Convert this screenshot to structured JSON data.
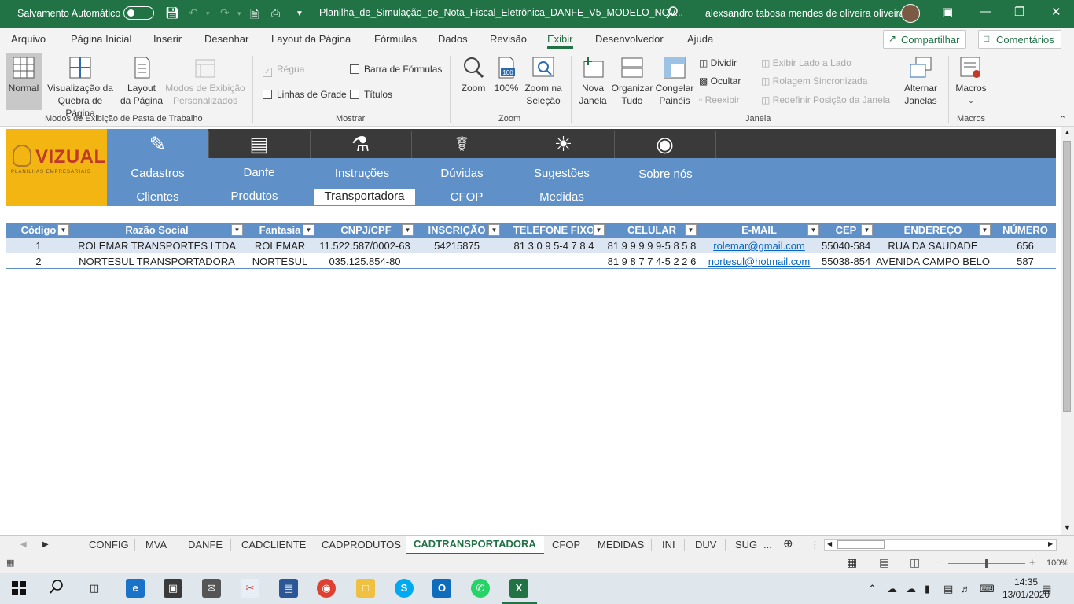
{
  "titlebar": {
    "autosave_label": "Salvamento Automático",
    "document_title": "Planilha_de_Simulação_de_Nota_Fiscal_Eletrônica_DANFE_V5_MODELO_NOV...",
    "user_name": "alexsandro tabosa mendes de oliveira oliveira"
  },
  "menu": {
    "tabs": [
      "Arquivo",
      "Página Inicial",
      "Inserir",
      "Desenhar",
      "Layout da Página",
      "Fórmulas",
      "Dados",
      "Revisão",
      "Exibir",
      "Desenvolvedor",
      "Ajuda"
    ],
    "active_tab": "Exibir",
    "share_label": "Compartilhar",
    "comments_label": "Comentários"
  },
  "ribbon": {
    "views": {
      "normal": "Normal",
      "page_break_1": "Visualização da",
      "page_break_2": "Quebra de Página",
      "page_layout_1": "Layout",
      "page_layout_2": "da Página",
      "custom_1": "Modos de Exibição",
      "custom_2": "Personalizados",
      "group_label": "Modos de Exibição de Pasta de Trabalho"
    },
    "show": {
      "ruler": "Régua",
      "formula_bar": "Barra de Fórmulas",
      "gridlines": "Linhas de Grade",
      "headings": "Títulos",
      "group_label": "Mostrar"
    },
    "zoom": {
      "zoom": "Zoom",
      "zoom_100": "100%",
      "icon_100": "100",
      "zoom_sel_1": "Zoom na",
      "zoom_sel_2": "Seleção",
      "group_label": "Zoom"
    },
    "window": {
      "new_1": "Nova",
      "new_2": "Janela",
      "arrange_1": "Organizar",
      "arrange_2": "Tudo",
      "freeze_1": "Congelar",
      "freeze_2": "Painéis",
      "split": "Dividir",
      "hide": "Ocultar",
      "unhide": "Reexibir",
      "side_by_side": "Exibir Lado a Lado",
      "sync_scroll": "Rolagem Sincronizada",
      "reset_pos": "Redefinir Posição da Janela",
      "switch_1": "Alternar",
      "switch_2": "Janelas",
      "group_label": "Janela"
    },
    "macros": {
      "label": "Macros",
      "group_label": "Macros"
    }
  },
  "logo": {
    "name": "VIZUAL",
    "tagline": "PLANILHAS EMPRESARIAIS"
  },
  "nav": {
    "top": [
      "Cadastros",
      "Danfe",
      "Instruções",
      "Dúvidas",
      "Sugestões",
      "Sobre nós"
    ],
    "bottom": [
      "Clientes",
      "Produtos",
      "Transportadora",
      "CFOP",
      "Medidas"
    ],
    "active_bottom": "Transportadora"
  },
  "table": {
    "headers": [
      "Código",
      "Razão Social",
      "Fantasia",
      "CNPJ/CPF",
      "INSCRIÇÃO",
      "TELEFONE FIXO",
      "CELULAR",
      "E-MAIL",
      "CEP",
      "ENDEREÇO",
      "NÚMERO"
    ],
    "rows": [
      [
        "1",
        "ROLEMAR TRANSPORTES LTDA",
        "ROLEMAR",
        "11.522.587/0002-63",
        "54215875",
        "81 3 0 9 5-4 7 8 4",
        "81 9 9 9 9 9-5 8 5 8",
        "rolemar@gmail.com",
        "55040-584",
        "RUA DA SAUDADE",
        "656"
      ],
      [
        "2",
        "NORTESUL TRANSPORTADORA",
        "NORTESUL",
        "035.125.854-80",
        "",
        "",
        "81 9 8 7 7 4-5 2 2 6",
        "nortesul@hotmail.com",
        "55038-854",
        "AVENIDA CAMPO BELO",
        "587"
      ]
    ]
  },
  "sheet_tabs": {
    "tabs": [
      "CONFIG",
      "MVA",
      "DANFE",
      "CADCLIENTE",
      "CADPRODUTOS",
      "CADTRANSPORTADORA",
      "CFOP",
      "MEDIDAS",
      "INI",
      "DUV",
      "SUG"
    ],
    "active": "CADTRANSPORTADORA",
    "more": "..."
  },
  "status": {
    "zoom_level": "100%",
    "zoom_fraction": 0.5
  },
  "taskbar": {
    "time": "14:35",
    "date": "13/01/2020"
  },
  "colors": {
    "excel_green": "#217346",
    "nav_blue": "#5f90c7",
    "nav_dark": "#3a3a3a",
    "logo_yellow": "#f2b511",
    "row_band": "#dce6f3"
  }
}
